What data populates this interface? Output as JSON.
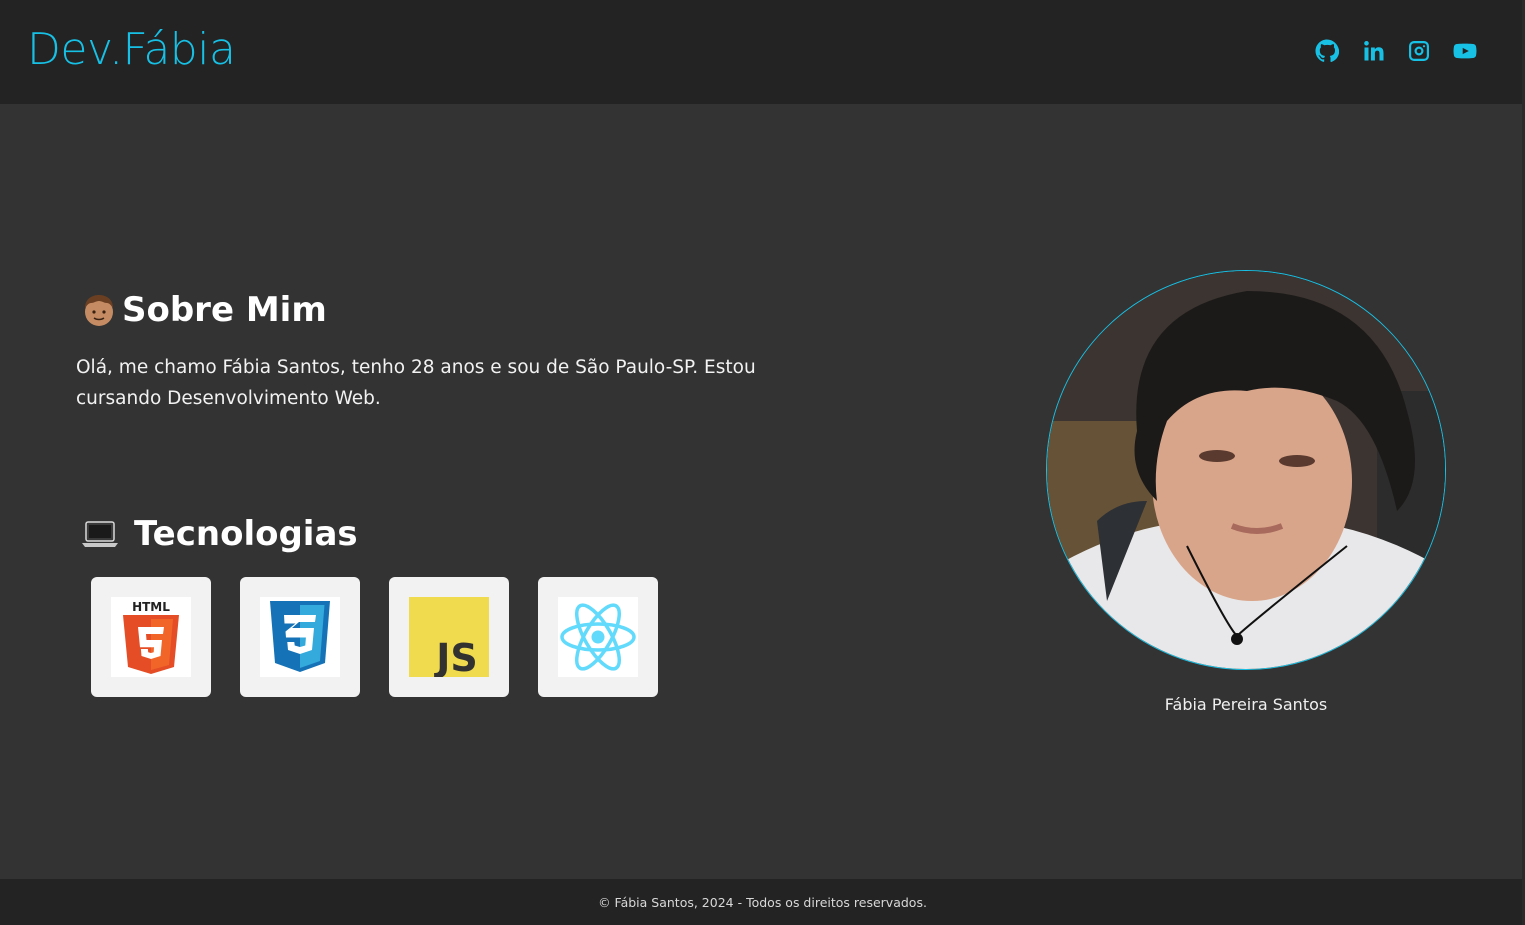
{
  "header": {
    "logo": "Dev.Fábia",
    "social": [
      {
        "icon": "github-icon"
      },
      {
        "icon": "linkedin-icon"
      },
      {
        "icon": "instagram-icon"
      },
      {
        "icon": "youtube-icon"
      }
    ]
  },
  "about": {
    "title": "Sobre Mim",
    "title_icon": "person-emoji-icon",
    "text": "Olá, me chamo Fábia Santos, tenho 28 anos e sou de São Paulo-SP. Estou cursando Desenvolvimento Web."
  },
  "technologies": {
    "title": "Tecnologias",
    "title_icon": "laptop-emoji-icon",
    "items": [
      {
        "icon": "html5-icon",
        "label": "HTML"
      },
      {
        "icon": "css3-icon"
      },
      {
        "icon": "javascript-icon",
        "label": "JS"
      },
      {
        "icon": "react-icon"
      }
    ]
  },
  "profile": {
    "caption": "Fábia Pereira Santos"
  },
  "footer": {
    "text": "© Fábia Santos, 2024 - Todos os direitos reservados."
  },
  "colors": {
    "accent": "#17c1e6",
    "header_bg": "#232323",
    "body_bg": "#333333"
  }
}
